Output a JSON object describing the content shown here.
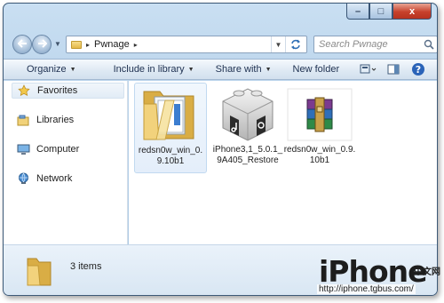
{
  "window": {
    "caption_buttons": {
      "minimize": "–",
      "maximize": "□",
      "close": "x"
    }
  },
  "navigation": {
    "back_icon": "arrow-left-icon",
    "forward_icon": "arrow-right-icon",
    "breadcrumb_separator": "▸",
    "breadcrumb": [
      "Pwnage"
    ],
    "search_placeholder": "Search Pwnage"
  },
  "toolbar": {
    "organize": "Organize",
    "include_in_library": "Include in library",
    "share_with": "Share with",
    "new_folder": "New folder",
    "dropdown_arrow": "▼"
  },
  "sidebar": {
    "items": [
      {
        "label": "Favorites",
        "icon": "star-icon"
      },
      {
        "label": "Libraries",
        "icon": "library-icon"
      },
      {
        "label": "Computer",
        "icon": "computer-icon"
      },
      {
        "label": "Network",
        "icon": "network-icon"
      }
    ]
  },
  "files": [
    {
      "name": "redsn0w_win_0.9.10b1",
      "type": "folder",
      "icon": "folder-icon"
    },
    {
      "name": "iPhone3,1_5.0.1_9A405_Restore",
      "type": "ipsw",
      "icon": "itunes-restore-icon"
    },
    {
      "name": "redsn0w_win_0.9.10b1",
      "type": "winrar",
      "icon": "winrar-archive-icon"
    }
  ],
  "details": {
    "item_count": "3 items"
  },
  "watermark": {
    "logo": "iPhone",
    "cn_text": "中文网",
    "url": "http://iphone.tgbus.com/"
  },
  "colors": {
    "window_frame": "#b7d1ea",
    "folder_yellow": "#e9c35a",
    "selection": "#e4eefa",
    "close_button": "#c7412c"
  }
}
